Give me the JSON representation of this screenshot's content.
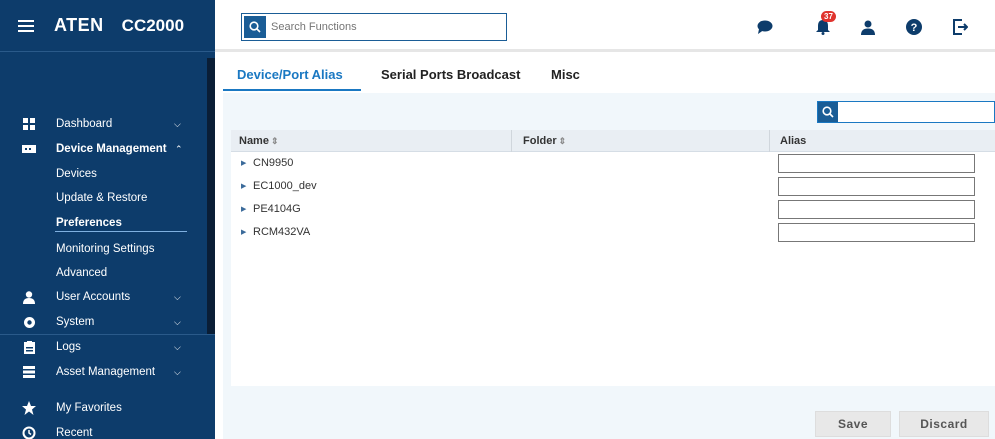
{
  "brand": {
    "logo": "ATEN",
    "model": "CC2000"
  },
  "sidebar": {
    "items": [
      {
        "label": "Dashboard",
        "icon": "dashboard-icon",
        "chevron": "down"
      },
      {
        "label": "Device Management",
        "icon": "device-icon",
        "chevron": "up",
        "bold": true
      },
      {
        "label": "Devices",
        "sub": true
      },
      {
        "label": "Update & Restore",
        "sub": true
      },
      {
        "label": "Preferences",
        "sub": true,
        "active": true
      },
      {
        "label": "Monitoring Settings",
        "sub": true
      },
      {
        "label": "Advanced",
        "sub": true
      },
      {
        "label": "User Accounts",
        "icon": "user-icon",
        "chevron": "down"
      },
      {
        "label": "System",
        "icon": "gear-icon",
        "chevron": "down"
      },
      {
        "label": "Logs",
        "icon": "clipboard-icon",
        "chevron": "down"
      },
      {
        "label": "Asset Management",
        "icon": "server-icon",
        "chevron": "down"
      },
      {
        "label": "My Favorites",
        "icon": "star-icon"
      },
      {
        "label": "Recent",
        "icon": "history-icon"
      }
    ]
  },
  "search": {
    "placeholder": "Search Functions"
  },
  "notifications": {
    "count": "37"
  },
  "tabs": [
    {
      "label": "Device/Port Alias",
      "active": true
    },
    {
      "label": "Serial Ports Broadcast"
    },
    {
      "label": "Misc"
    }
  ],
  "table": {
    "columns": [
      "Name",
      "Folder",
      "Alias"
    ],
    "rows": [
      {
        "name": "CN9950",
        "alias": ""
      },
      {
        "name": "EC1000_dev",
        "alias": ""
      },
      {
        "name": "PE4104G",
        "alias": ""
      },
      {
        "name": "RCM432VA",
        "alias": ""
      }
    ]
  },
  "actions": {
    "save": "Save",
    "discard": "Discard"
  },
  "colors": {
    "sidebar": "#0d3c6b",
    "accent": "#1a78c2",
    "badge": "#e0342e"
  }
}
